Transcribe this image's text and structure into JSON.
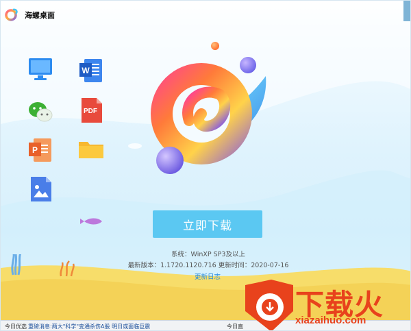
{
  "app": {
    "title": "海螺桌面"
  },
  "desktop_icons": [
    {
      "name": "monitor-icon",
      "color": "#2d8cf0"
    },
    {
      "name": "word-icon",
      "color": "#2b6fd6"
    },
    {
      "name": "wechat-icon",
      "color": "#3cb034"
    },
    {
      "name": "pdf-icon",
      "color": "#e84a3c"
    },
    {
      "name": "ppt-icon",
      "color": "#f0783a"
    },
    {
      "name": "folder-icon",
      "color": "#f7b82f"
    },
    {
      "name": "image-icon",
      "color": "#4a7ee8"
    }
  ],
  "download": {
    "button_label": "立即下载"
  },
  "info": {
    "system": "系统：WinXP SP3及以上",
    "version": "最新版本：1.1720.1120.716   更新时间：2020-07-16",
    "changelog": "更新日志"
  },
  "bottom_strip": {
    "left": "今日优选",
    "middle": "重磅消息:两大\"科学\"变通杀伤A股 明日或面临巨震",
    "right": "今日直"
  },
  "watermark": {
    "text": "下载火",
    "url": "xiazaihuo.com"
  },
  "colors": {
    "accent": "#5bc8f2",
    "link": "#2a8de0",
    "watermark": "#e8421c"
  }
}
